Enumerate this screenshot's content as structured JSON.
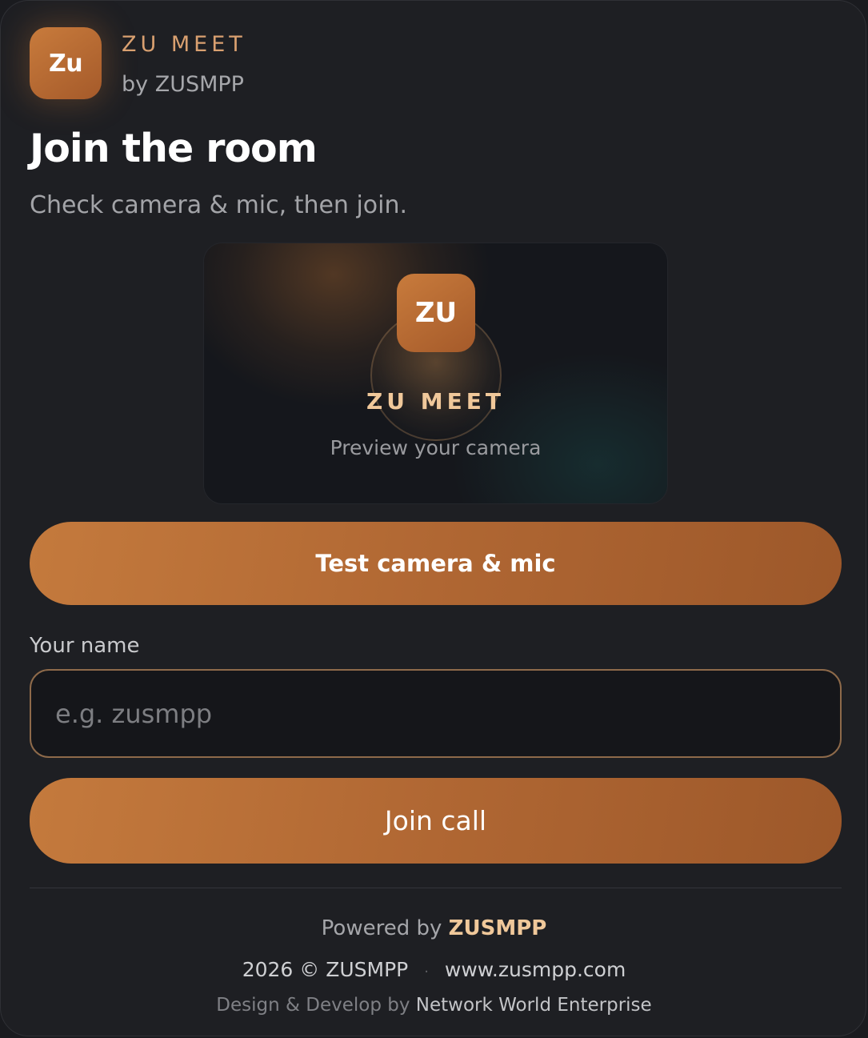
{
  "brand": {
    "logo_text": "Zu",
    "name": "ZU MEET",
    "by": "by ZUSMPP"
  },
  "heading": {
    "title": "Join the room",
    "subtitle": "Check camera & mic, then join."
  },
  "preview": {
    "logo_text": "ZU",
    "name": "ZU MEET",
    "caption": "Preview your camera"
  },
  "actions": {
    "test_label": "Test camera & mic",
    "join_label": "Join call"
  },
  "form": {
    "name_label": "Your name",
    "name_placeholder": "e.g. zusmpp",
    "name_value": ""
  },
  "footer": {
    "powered_prefix": "Powered by",
    "powered_brand": "ZUSMPP",
    "copyright": "2026 © ZUSMPP",
    "separator": "·",
    "website": "www.zusmpp.com",
    "credit_prefix": "Design & Develop by",
    "credit_company": "Network World Enterprise"
  },
  "colors": {
    "accent": "#c47a3d",
    "accent_text": "#f0c89a",
    "background": "#1e1f23",
    "input_border": "#8e6a4a"
  }
}
